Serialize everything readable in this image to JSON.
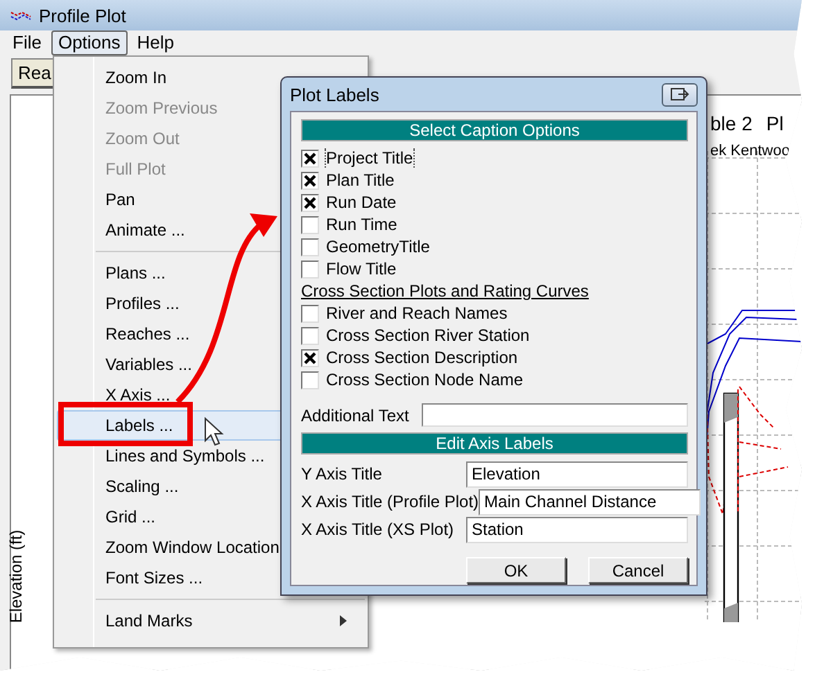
{
  "window": {
    "title": "Profile Plot"
  },
  "menubar": [
    {
      "label": "File",
      "selected": false
    },
    {
      "label": "Options",
      "selected": true
    },
    {
      "label": "Help",
      "selected": false
    }
  ],
  "toolbar": {
    "button": "Rea"
  },
  "plot": {
    "y_axis_label": "Elevation (ft)",
    "title_parts": [
      "ble 2",
      "Pl"
    ],
    "subtitle": "ek Kentwoo"
  },
  "options_menu": [
    {
      "kind": "item",
      "label": "Zoom In",
      "disabled": false,
      "selected": false
    },
    {
      "kind": "item",
      "label": "Zoom Previous",
      "disabled": true,
      "selected": false
    },
    {
      "kind": "item",
      "label": "Zoom Out",
      "disabled": true,
      "selected": false
    },
    {
      "kind": "item",
      "label": "Full Plot",
      "disabled": true,
      "selected": false
    },
    {
      "kind": "item",
      "label": "Pan",
      "disabled": false,
      "selected": false
    },
    {
      "kind": "item",
      "label": "Animate ...",
      "disabled": false,
      "selected": false
    },
    {
      "kind": "separator"
    },
    {
      "kind": "item",
      "label": "Plans ...",
      "disabled": false,
      "selected": false
    },
    {
      "kind": "item",
      "label": "Profiles ...",
      "disabled": false,
      "selected": false
    },
    {
      "kind": "item",
      "label": "Reaches ...",
      "disabled": false,
      "selected": false
    },
    {
      "kind": "item",
      "label": "Variables ...",
      "disabled": false,
      "selected": false
    },
    {
      "kind": "item",
      "label": "X Axis ...",
      "disabled": false,
      "selected": false
    },
    {
      "kind": "item",
      "label": "Labels ...",
      "disabled": false,
      "selected": true
    },
    {
      "kind": "item",
      "label": "Lines and Symbols ...",
      "disabled": false,
      "selected": false
    },
    {
      "kind": "item",
      "label": "Scaling ...",
      "disabled": false,
      "selected": false
    },
    {
      "kind": "item",
      "label": "Grid ...",
      "disabled": false,
      "selected": false
    },
    {
      "kind": "item",
      "label": "Zoom Window Location",
      "disabled": false,
      "selected": false
    },
    {
      "kind": "item",
      "label": "Font Sizes ...",
      "disabled": false,
      "selected": false
    },
    {
      "kind": "separator"
    },
    {
      "kind": "submenu",
      "label": "Land Marks",
      "disabled": false,
      "selected": false
    }
  ],
  "dialog": {
    "title": "Plot Labels",
    "caption_header": "Select Caption Options",
    "options": [
      {
        "kind": "checkbox",
        "label": "Project Title",
        "checked": true
      },
      {
        "kind": "checkbox",
        "label": "Plan Title",
        "checked": true
      },
      {
        "kind": "checkbox",
        "label": "Run Date",
        "checked": true
      },
      {
        "kind": "checkbox",
        "label": "Run Time",
        "checked": false
      },
      {
        "kind": "checkbox",
        "label": "GeometryTitle",
        "checked": false
      },
      {
        "kind": "checkbox",
        "label": "Flow Title",
        "checked": false
      },
      {
        "kind": "heading",
        "label": "Cross Section Plots and Rating Curves"
      },
      {
        "kind": "checkbox",
        "label": "River and Reach Names",
        "checked": false
      },
      {
        "kind": "checkbox",
        "label": "Cross Section River Station",
        "checked": false
      },
      {
        "kind": "checkbox",
        "label": "Cross Section Description",
        "checked": true
      },
      {
        "kind": "checkbox",
        "label": "Cross Section Node Name",
        "checked": false
      }
    ],
    "additional_text": {
      "label": "Additional Text"
    },
    "axis_header": "Edit Axis Labels",
    "axis_fields": [
      {
        "label": "Y Axis Title",
        "value": "Elevation"
      },
      {
        "label": "X Axis Title (Profile  Plot)",
        "value": "Main Channel Distance"
      },
      {
        "label": "X Axis Title (XS  Plot)",
        "value": "Station"
      }
    ],
    "buttons": [
      "OK",
      "Cancel"
    ]
  }
}
